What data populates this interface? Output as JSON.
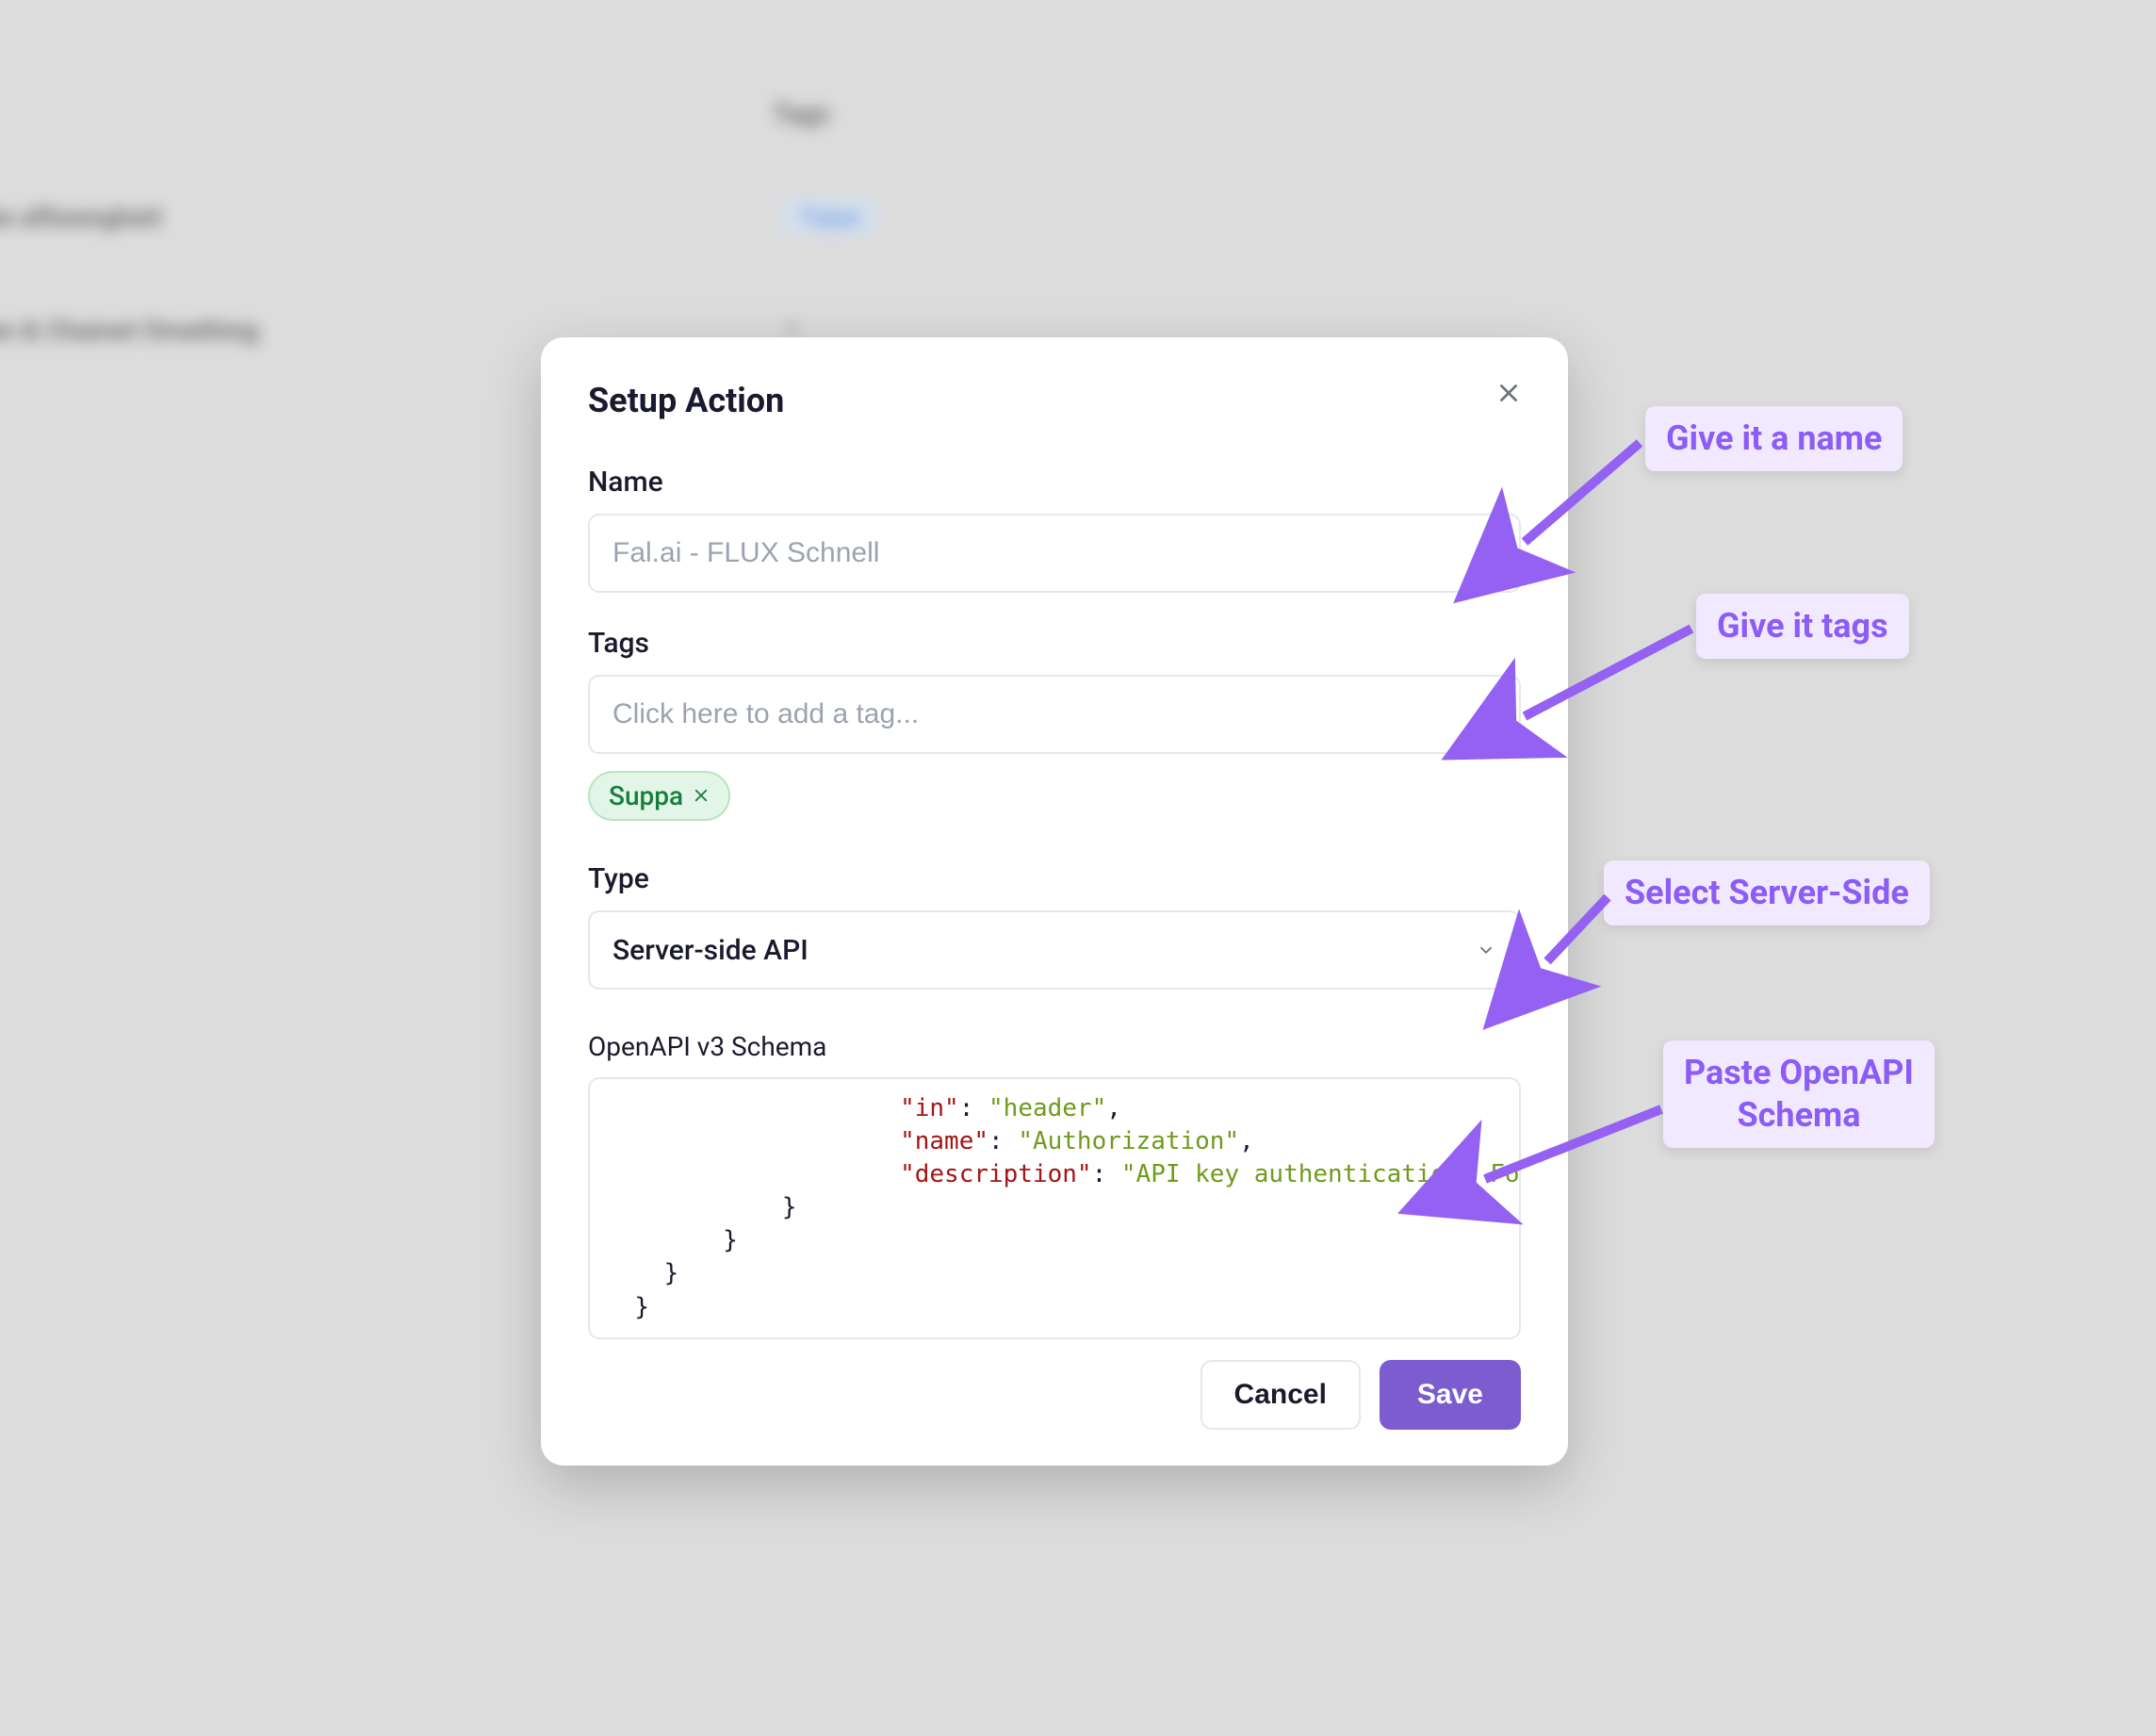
{
  "modal": {
    "title": "Setup Action",
    "name_label": "Name",
    "name_placeholder": "Fal.ai - FLUX Schnell",
    "tags_label": "Tags",
    "tags_placeholder": "Click here to add a tag...",
    "tag_chip": "Suppa",
    "type_label": "Type",
    "type_value": "Server-side API",
    "schema_label": "OpenAPI v3 Schema",
    "schema_lines": [
      {
        "indent": 6,
        "key": "\"in\"",
        "value": "\"header\"",
        "comma": true
      },
      {
        "indent": 6,
        "key": "\"name\"",
        "value": "\"Authorization\"",
        "comma": true
      },
      {
        "indent": 6,
        "key": "\"description\"",
        "value": "\"API key authentication. Format: Key {API_KEY}\"",
        "comma": false
      },
      {
        "indent": 5,
        "brace": "}"
      },
      {
        "indent": 3,
        "brace": "}"
      },
      {
        "indent": 1,
        "brace": "}"
      },
      {
        "indent": 0,
        "brace": "}"
      }
    ],
    "cancel_label": "Cancel",
    "save_label": "Save"
  },
  "annotations": {
    "a1": "Give it a name",
    "a2": "Give it tags",
    "a3": "Select Server-Side",
    "a4": "Paste OpenAPI\nSchema"
  }
}
